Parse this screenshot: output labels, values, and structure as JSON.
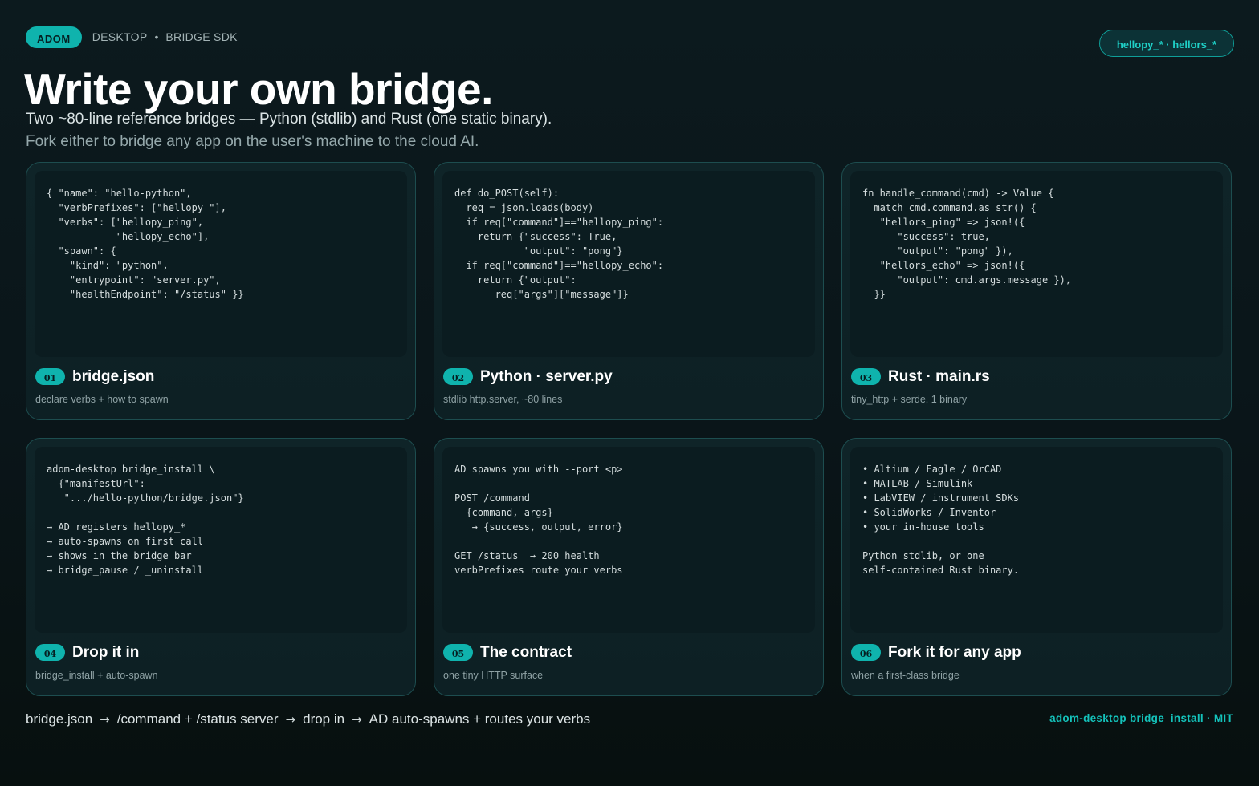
{
  "header": {
    "brand": "ADOM",
    "crumbs": [
      "DESKTOP",
      "BRIDGE SDK"
    ],
    "separator": "•",
    "verbs_pill": "hellopy_* · hellors_*"
  },
  "title": "Write your own bridge.",
  "subtitle_line1": "Two ~80-line reference bridges — Python (stdlib) and Rust (one static binary).",
  "subtitle_line2": "Fork either to bridge any app on the user's machine to the cloud AI.",
  "cards": [
    {
      "num": "01",
      "title": "bridge.json",
      "caption": "declare verbs + how to spawn",
      "code": "{ \"name\": \"hello-python\",\n  \"verbPrefixes\": [\"hellopy_\"],\n  \"verbs\": [\"hellopy_ping\",\n            \"hellopy_echo\"],\n  \"spawn\": {\n    \"kind\": \"python\",\n    \"entrypoint\": \"server.py\",\n    \"healthEndpoint\": \"/status\" }}"
    },
    {
      "num": "02",
      "title": "Python · server.py",
      "caption": "stdlib http.server, ~80 lines",
      "code": "def do_POST(self):\n  req = json.loads(body)\n  if req[\"command\"]==\"hellopy_ping\":\n    return {\"success\": True,\n            \"output\": \"pong\"}\n  if req[\"command\"]==\"hellopy_echo\":\n    return {\"output\":\n       req[\"args\"][\"message\"]}"
    },
    {
      "num": "03",
      "title": "Rust · main.rs",
      "caption": "tiny_http + serde, 1 binary",
      "code": "fn handle_command(cmd) -> Value {\n  match cmd.command.as_str() {\n   \"hellors_ping\" => json!({\n      \"success\": true,\n      \"output\": \"pong\" }),\n   \"hellors_echo\" => json!({\n      \"output\": cmd.args.message }),\n  }}"
    },
    {
      "num": "04",
      "title": "Drop it in",
      "caption": "bridge_install + auto-spawn",
      "code": "adom-desktop bridge_install \\\n  {\"manifestUrl\":\n   \".../hello-python/bridge.json\"}\n\n→ AD registers hellopy_*\n→ auto-spawns on first call\n→ shows in the bridge bar\n→ bridge_pause / _uninstall"
    },
    {
      "num": "05",
      "title": "The contract",
      "caption": "one tiny HTTP surface",
      "code": "AD spawns you with --port <p>\n\nPOST /command\n  {command, args}\n   → {success, output, error}\n\nGET /status  → 200 health\nverbPrefixes route your verbs"
    },
    {
      "num": "06",
      "title": "Fork it for any app",
      "caption": "when a first-class bridge",
      "code": "• Altium / Eagle / OrCAD\n• MATLAB / Simulink\n• LabVIEW / instrument SDKs\n• SolidWorks / Inventor\n• your in-house tools\n\nPython stdlib, or one\nself-contained Rust binary."
    }
  ],
  "footer": {
    "flow": [
      "bridge.json",
      "/command + /status server",
      "drop in",
      "AD auto-spawns + routes your verbs"
    ],
    "arrow": "→",
    "right": "adom-desktop bridge_install · MIT"
  }
}
